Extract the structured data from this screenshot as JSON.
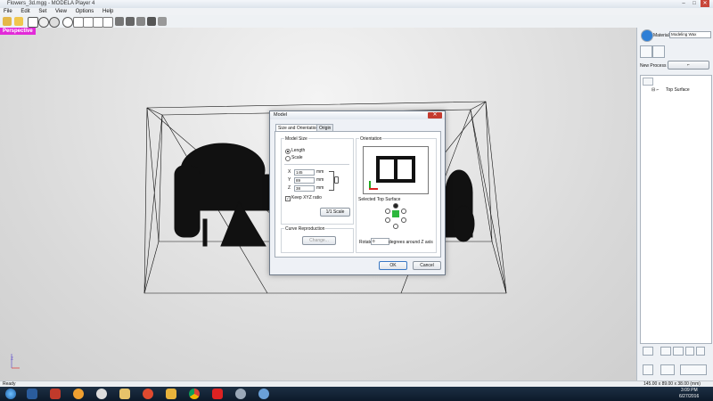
{
  "window": {
    "title": "Flowers_3d.mgg - MODELA Player 4",
    "minimize": "–",
    "maximize": "□",
    "close": "✕"
  },
  "menu": [
    "File",
    "Edit",
    "Set",
    "View",
    "Options",
    "Help"
  ],
  "viewport": {
    "view_label": "Perspective",
    "axis_z": "z",
    "axis_x": "x"
  },
  "right_panel": {
    "material_label": "Material",
    "material_value": "Modeling Wax",
    "new_process_label": "New Process",
    "tree_item": "Top Surface"
  },
  "dialog": {
    "title": "Model",
    "close": "✕",
    "tabs": [
      "Size and Orientation",
      "Origin"
    ],
    "model_size": {
      "group_label": "Model Size",
      "length_label": "Length",
      "scale_label": "Scale",
      "x_label": "X",
      "x_value": "145",
      "x_unit": "mm",
      "y_label": "Y",
      "y_value": "89",
      "y_unit": "mm",
      "z_label": "Z",
      "z_value": "38",
      "z_unit": "mm",
      "keep_ratio_label": "Keep XYZ ratio",
      "one_to_one": "1/1 Scale"
    },
    "curve": {
      "group_label": "Curve Reproduction",
      "change_button": "Change..."
    },
    "orientation": {
      "group_label": "Orientation",
      "selected_top_label": "Selected Top Surface",
      "rotate_label": "Rotate",
      "rotate_value": "0",
      "rotate_suffix": "degrees around Z axis"
    },
    "ok": "OK",
    "cancel": "Cancel"
  },
  "status": {
    "left": "Ready",
    "right": "145.00 x 89.00 x 38.00 (mm)"
  },
  "taskbar": {
    "time": "3:09 PM",
    "date": "6/27/2016"
  },
  "colors": {
    "accent": "#e22ad8",
    "close_red": "#c43b2f",
    "taskbar": "#0d1a2a"
  }
}
